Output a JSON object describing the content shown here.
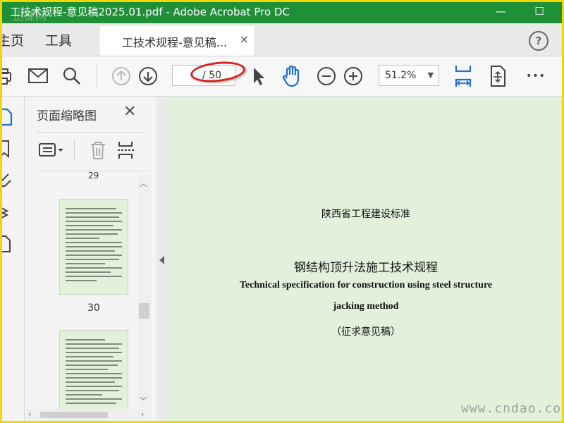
{
  "window": {
    "title": "工技术规程-意见稿2025.01.pdf - Adobe Acrobat Pro DC",
    "watermark": "迅捷网",
    "min_label": "—",
    "max_label": "☐"
  },
  "menubar": {
    "home_label": "主页",
    "tools_label": "工具",
    "doc_tab": "工技术规程-意见稿...",
    "close_tab": "×",
    "help": "?"
  },
  "toolbar": {
    "page_current": "",
    "page_total": "/ 50",
    "zoom": "51.2%",
    "more": "•••"
  },
  "thumbnail_panel": {
    "title": "页面缩略图",
    "close": "✕",
    "partial_label": "29",
    "page30_label": "30"
  },
  "document": {
    "line1": "陕西省工程建设标准",
    "title_cn": "钢结构顶升法施工技术规程",
    "title_en_1": "Technical specification for construction using steel structure",
    "title_en_2": "jacking method",
    "note": "（征求意见稿）"
  },
  "watermark_bottom": "www.cndao.com"
}
